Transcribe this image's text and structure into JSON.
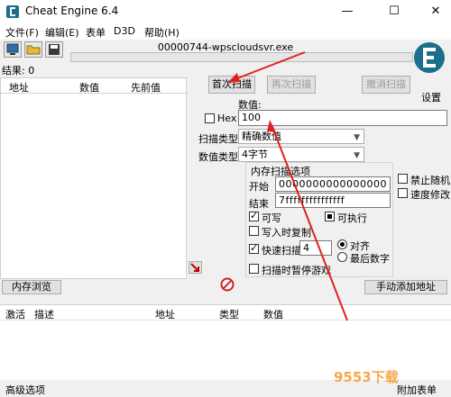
{
  "window": {
    "title": "Cheat Engine 6.4",
    "minimize": "—",
    "maximize": "☐",
    "close": "✕"
  },
  "menu": [
    "文件(F)",
    "编辑(E)",
    "表单",
    "D3D",
    "帮助(H)"
  ],
  "process_name": "00000744-wpscloudsvr.exe",
  "results_label": "结果: 0",
  "list_columns": [
    "地址",
    "数值",
    "先前值"
  ],
  "buttons": {
    "first_scan": "首次扫描",
    "next_scan": "再次扫描",
    "undo_scan": "撤消扫描",
    "memory_view": "内存浏览",
    "add_address": "手动添加地址"
  },
  "settings_label": "设置",
  "value_section": {
    "label": "数值:",
    "hex_label": "Hex",
    "value": "100"
  },
  "scan_type": {
    "label": "扫描类型",
    "value": "精确数值"
  },
  "value_type": {
    "label": "数值类型",
    "value": "4字节"
  },
  "memory_options": {
    "title": "内存扫描选项",
    "start_label": "开始",
    "start_value": "0000000000000000",
    "stop_label": "结束",
    "stop_value": "7fffffffffffffff",
    "writable": "可写",
    "executable": "可执行",
    "copy_on_write": "写入时复制",
    "fast_scan": "快速扫描",
    "fast_scan_value": "4",
    "align": "对齐",
    "last_digits": "最后数字",
    "pause_game": "扫描时暂停游戏"
  },
  "right_options": {
    "disable_random": "禁止随机",
    "speedhack": "速度修改"
  },
  "address_columns": [
    "激活",
    "描述",
    "地址",
    "类型",
    "数值"
  ],
  "status": {
    "advanced": "高级选项",
    "table_extras": "附加表单"
  },
  "watermark": "9553下载",
  "colors": {
    "arrow": "#e02020",
    "logo": "#1a6f8a"
  }
}
